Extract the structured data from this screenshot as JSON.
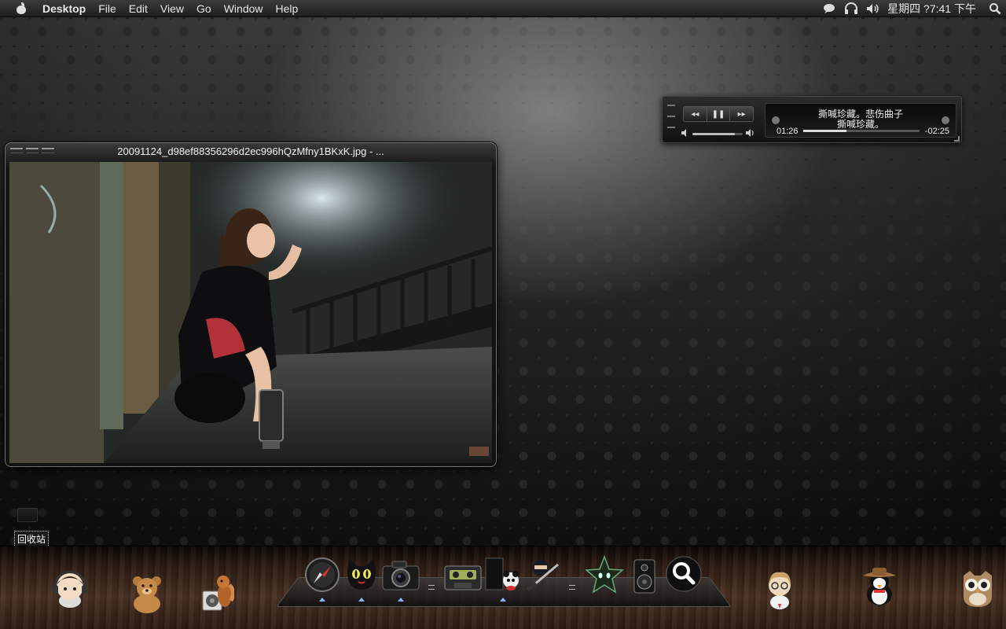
{
  "menubar": {
    "app_name": "Desktop",
    "menus": [
      "File",
      "Edit",
      "View",
      "Go",
      "Window",
      "Help"
    ],
    "clock": "星期四 ?7:41 下午",
    "status_icons": [
      "speech-bubble-icon",
      "headphones-icon",
      "volume-icon",
      "spotlight-search-icon"
    ],
    "media_notch": {
      "prev": "◂◂",
      "play": "▶",
      "next": "▸▸"
    }
  },
  "music_widget": {
    "line1": "撕喊珍藏。悲伤曲子",
    "line2": "撕喊珍藏。",
    "elapsed": "01:26",
    "remaining": "-02:25",
    "progress": 0.37,
    "volume": 0.85,
    "buttons": {
      "rewind": "◂◂",
      "pause": "❚❚",
      "forward": "▸▸"
    }
  },
  "image_viewer": {
    "title": "20091124_d98ef88356296d2ec996hQzMfny1BKxK.jpg - ..."
  },
  "desktop": {
    "trash_label": "回收站"
  },
  "dock": {
    "left_items": [
      "headphone-boy-icon",
      "teddy-bear-icon",
      "chipmunk-speaker-icon"
    ],
    "center_items": [
      "safari-compass-icon",
      "cat-face-icon",
      "camera-icon",
      "cassette-tape-icon",
      "panda-book-icon",
      "ninja-sword-icon",
      "dark-star-icon",
      "speaker-icon",
      "search-magnifier-icon"
    ],
    "right_items": [
      "girl-avatar-icon",
      "cowboy-penguin-icon",
      "owl-icon"
    ]
  }
}
